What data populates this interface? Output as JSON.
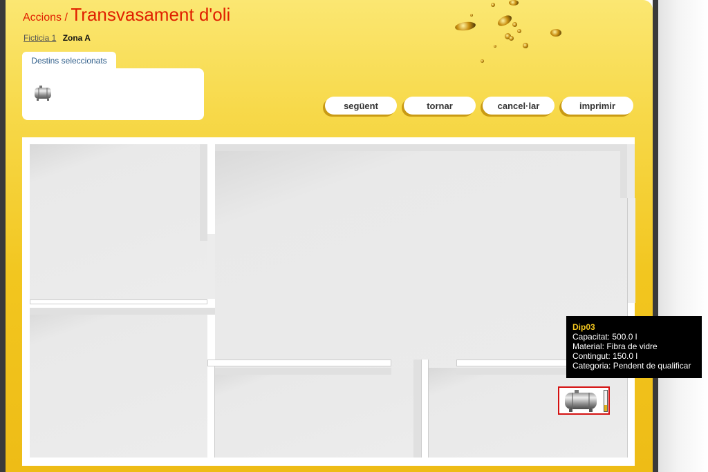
{
  "header": {
    "prefix": "Accions /",
    "title": "Transvasament d'oli"
  },
  "breadcrumb": {
    "building": "Ficticia 1",
    "zone": "Zona A"
  },
  "destinations": {
    "tab_label": "Destins seleccionats",
    "icon": "tank-icon"
  },
  "actions": {
    "next": "següent",
    "back": "tornar",
    "cancel": "cancel·lar",
    "print": "imprimir"
  },
  "tooltip": {
    "name": "Dip03",
    "capacity": "Capacitat: 500.0 l",
    "material": "Material: Fibra de vidre",
    "content": "Contingut: 150.0 l",
    "category": "Categoria: Pendent de qualificar"
  },
  "tank": {
    "name": "Dip03",
    "level_fraction": 0.3,
    "icon": "tank-icon"
  },
  "colors": {
    "accent_red": "#e02000",
    "panel_yellow": "#f2c61f",
    "selected_border": "#d41010",
    "tooltip_title": "#f2c61f"
  }
}
